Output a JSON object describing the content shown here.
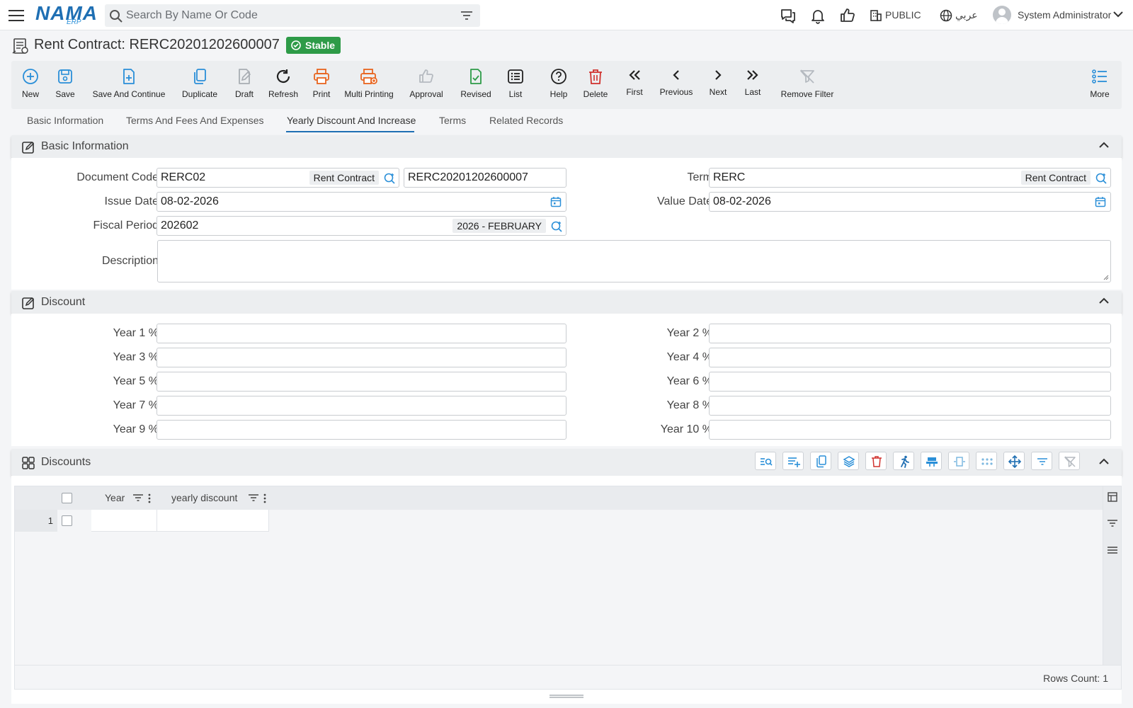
{
  "topbar": {
    "logo_text": "NAMA",
    "logo_sub": "ERP",
    "search_placeholder": "Search By Name Or Code",
    "branch": "PUBLIC",
    "language": "عربي",
    "user_name": "System Administrator",
    "icons": [
      "hamburger-icon",
      "search-icon",
      "filter-icon",
      "chat-icon",
      "bell-icon",
      "thumbs-up-icon",
      "building-icon",
      "globe-icon",
      "avatar",
      "chevron-down-icon"
    ]
  },
  "header": {
    "title": "Rent Contract: RERC20201202600007",
    "status": "Stable",
    "status_color": "#2e9b48"
  },
  "toolbar": {
    "new": "New",
    "save": "Save",
    "save_continue": "Save And Continue",
    "duplicate": "Duplicate",
    "draft": "Draft",
    "refresh": "Refresh",
    "print": "Print",
    "multi_printing": "Multi Printing",
    "approval": "Approval",
    "revised": "Revised",
    "list": "List",
    "help": "Help",
    "delete": "Delete",
    "first": "First",
    "previous": "Previous",
    "next": "Next",
    "last": "Last",
    "remove_filter": "Remove Filter",
    "more": "More"
  },
  "tabs": [
    {
      "label": "Basic Information"
    },
    {
      "label": "Terms And Fees And Expenses"
    },
    {
      "label": "Yearly Discount And Increase",
      "active": true
    },
    {
      "label": "Terms"
    },
    {
      "label": "Related Records"
    }
  ],
  "basic_info": {
    "title": "Basic Information",
    "document_code": {
      "label": "Document Code",
      "value": "RERC02",
      "tag": "Rent Contract",
      "code": "RERC20201202600007"
    },
    "term": {
      "label": "Term",
      "value": "RERC",
      "tag": "Rent Contract"
    },
    "issue_date": {
      "label": "Issue Date",
      "value": "08-02-2026"
    },
    "value_date": {
      "label": "Value Date",
      "value": "08-02-2026"
    },
    "fiscal_period": {
      "label": "Fiscal Period",
      "value": "202602",
      "tag": "2026 - FEBRUARY"
    },
    "description": {
      "label": "Description",
      "value": ""
    }
  },
  "discount": {
    "title": "Discount",
    "years": [
      {
        "label": "Year 1 %",
        "value": ""
      },
      {
        "label": "Year 2 %",
        "value": ""
      },
      {
        "label": "Year 3 %",
        "value": ""
      },
      {
        "label": "Year 4 %",
        "value": ""
      },
      {
        "label": "Year 5 %",
        "value": ""
      },
      {
        "label": "Year 6 %",
        "value": ""
      },
      {
        "label": "Year 7 %",
        "value": ""
      },
      {
        "label": "Year 8 %",
        "value": ""
      },
      {
        "label": "Year 9 %",
        "value": ""
      },
      {
        "label": "Year 10 %",
        "value": ""
      }
    ]
  },
  "discounts_grid": {
    "title": "Discounts",
    "columns": [
      {
        "label": "Year"
      },
      {
        "label": "yearly discount"
      }
    ],
    "rows": [
      {
        "num": "1",
        "year": "",
        "yearly_discount": ""
      }
    ],
    "rows_count": "Rows Count: 1"
  },
  "colors": {
    "accent": "#1f6fb3",
    "icon_blue": "#2a8fd8",
    "print_orange": "#e8651f",
    "delete_red": "#d0312d",
    "approve_green": "#2e9b48"
  }
}
